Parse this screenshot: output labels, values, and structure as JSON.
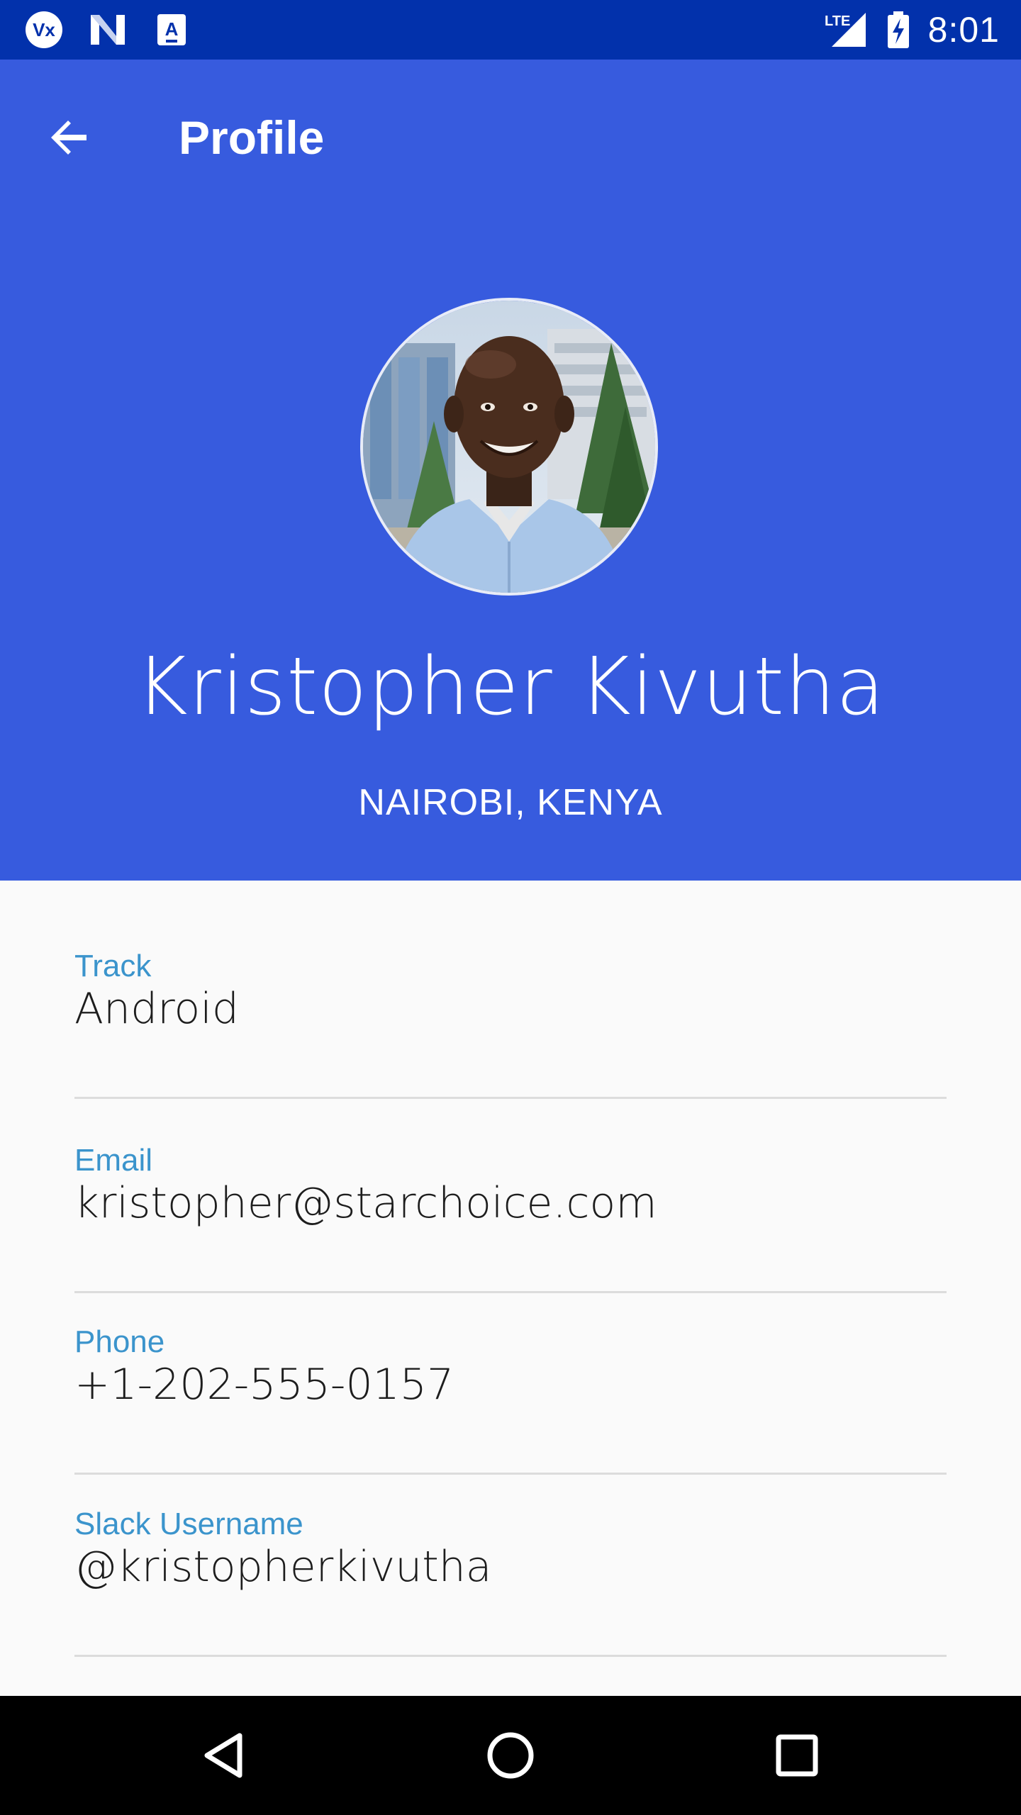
{
  "status_bar": {
    "left_icons": [
      "vx-app-icon",
      "n-app-icon",
      "a-app-icon"
    ],
    "right_icons": [
      "lte-signal-icon",
      "battery-charging-icon"
    ],
    "network_label": "LTE",
    "time": "8:01",
    "background": "#0231ab"
  },
  "app_bar": {
    "back_icon": "arrow-back-icon",
    "title": "Profile"
  },
  "profile": {
    "avatar": "profile-photo",
    "name": "Kristopher Kivutha",
    "location": "NAIROBI, KENYA",
    "header_color": "#375bde"
  },
  "details": [
    {
      "label": "Track",
      "value": "Android"
    },
    {
      "label": "Email",
      "value": "kristopher@starchoice.com"
    },
    {
      "label": "Phone",
      "value": "+1-202-555-0157"
    },
    {
      "label": "Slack Username",
      "value": "@kristopherkivutha"
    }
  ],
  "colors": {
    "label": "#3b94cc",
    "value": "#1d1d1d",
    "divider": "#dcdcdc",
    "page_background": "#fafafa"
  },
  "nav_bar": {
    "buttons": [
      "nav-back-icon",
      "nav-home-icon",
      "nav-recents-icon"
    ]
  }
}
